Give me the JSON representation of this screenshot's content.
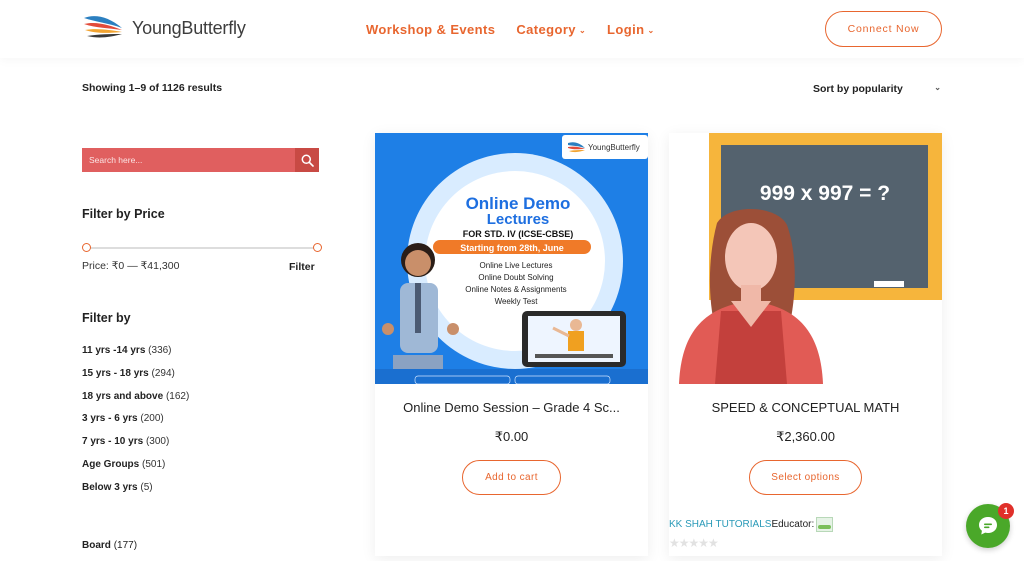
{
  "header": {
    "logo_text": "YoungButterfly",
    "nav": [
      {
        "label": "Workshop & Events"
      },
      {
        "label": "Category"
      },
      {
        "label": "Login"
      }
    ],
    "connect_label": "Connect Now"
  },
  "toolbar": {
    "results_text": "Showing 1–9 of 1126 results",
    "sort_value": "Sort by popularity"
  },
  "sidebar": {
    "search_placeholder": "Search here...",
    "price_filter": {
      "title": "Filter by Price",
      "range_text": "Price: ₹0 — ₹41,300",
      "button_label": "Filter",
      "min_fraction": 0,
      "max_fraction": 1
    },
    "filter_by": {
      "title": "Filter by",
      "items": [
        {
          "term": "11 yrs -14 yrs",
          "count": "(336)"
        },
        {
          "term": "15 yrs - 18 yrs",
          "count": "(294)"
        },
        {
          "term": "18 yrs and above",
          "count": "(162)"
        },
        {
          "term": "3 yrs - 6 yrs",
          "count": "(200)"
        },
        {
          "term": "7 yrs - 10 yrs",
          "count": "(300)"
        },
        {
          "term": "Age Groups",
          "count": "(501)"
        },
        {
          "term": "Below 3 yrs",
          "count": "(5)"
        }
      ]
    },
    "board": {
      "term": "Board",
      "count": "(177)"
    }
  },
  "products": [
    {
      "title": "Online Demo Session – Grade 4 Sc...",
      "price": "₹0.00",
      "button": "Add to cart",
      "image": {
        "logo_text": "YoungButterfly",
        "heading_line1": "Online Demo",
        "heading_line2": "Lectures",
        "subheading": "FOR STD. IV (ICSE-CBSE)",
        "date_banner": "Starting from 28th, June",
        "bullets": [
          "Online Live Lectures",
          "Online Doubt Solving",
          "Online Notes & Assignments",
          "Weekly Test"
        ]
      }
    },
    {
      "title": "SPEED & CONCEPTUAL MATH",
      "price": "₹2,360.00",
      "button": "Select options",
      "vendor": "KK SHAH TUTORIALS",
      "educator_label": "Educator:",
      "rating_stars": "★★★★★",
      "rating": 0,
      "image": {
        "board_text": "999 x 997 = ?"
      }
    }
  ],
  "chat": {
    "badge_count": "1"
  },
  "colors": {
    "accent": "#e8662f",
    "search_bg": "#e05f5f",
    "promo_blue": "#1e7fe6",
    "chat_green": "#4aa829"
  }
}
